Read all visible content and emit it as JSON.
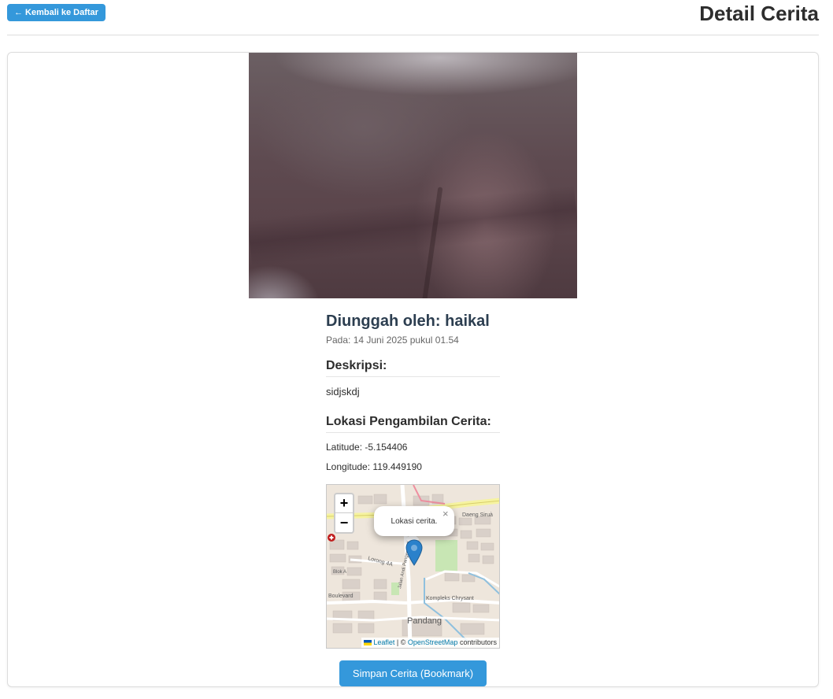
{
  "header": {
    "back_arrow": "←",
    "back_label": "Kembali ke Daftar",
    "title": "Detail Cerita"
  },
  "story": {
    "uploader_label": "Diunggah oleh:",
    "uploader": "haikal",
    "date_label": "Pada:",
    "date": "14 Juni 2025 pukul 01.54",
    "description_title": "Deskripsi:",
    "description": "sidjskdj",
    "location_title": "Lokasi Pengambilan Cerita:",
    "latitude_label": "Latitude:",
    "latitude": "-5.154406",
    "longitude_label": "Longitude:",
    "longitude": "119.449190"
  },
  "map": {
    "zoom_in": "+",
    "zoom_out": "−",
    "popup_text": "Lokasi cerita.",
    "popup_close": "×",
    "attribution_leaflet": "Leaflet",
    "attribution_sep": "| ©",
    "attribution_osm": "OpenStreetMap",
    "attribution_suffix": "contributors",
    "labels": {
      "place": "Pandang",
      "road1": "Jalan Andi Pangeran Pettarani",
      "complex": "Kompleks Chrysant",
      "lorong": "Lorong 4A",
      "blok": "Blok A",
      "boulevard": "Boulevard",
      "daeng": "Daeng Siruà"
    },
    "marker_color": "#2a81cb"
  },
  "actions": {
    "bookmark_label": "Simpan Cerita (Bookmark)"
  },
  "colors": {
    "accent": "#3498db",
    "title": "#2c3e50"
  }
}
